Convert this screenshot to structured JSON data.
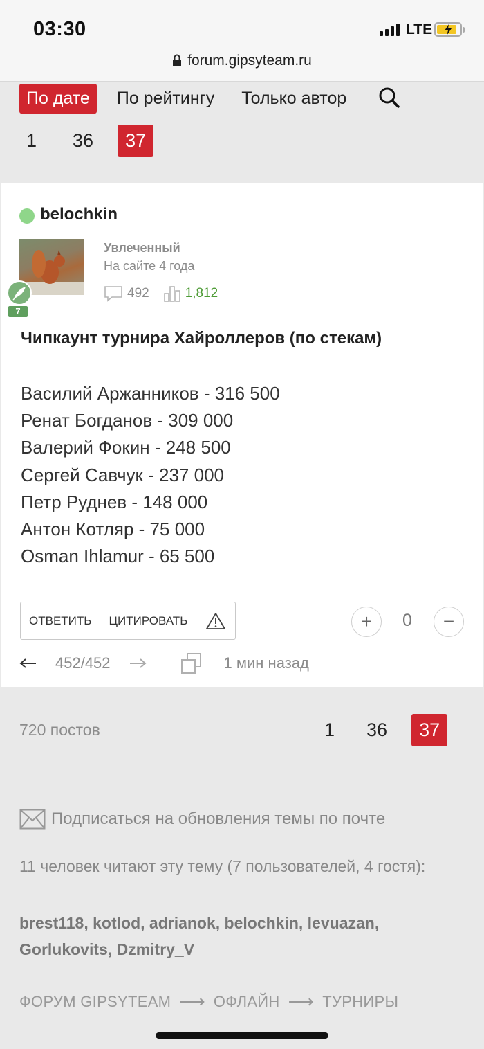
{
  "status_bar": {
    "time": "03:30",
    "network": "LTE"
  },
  "url_bar": {
    "url": "forum.gipsyteam.ru"
  },
  "sort_tabs": [
    "По дате",
    "По рейтингу",
    "Только автор"
  ],
  "pagination": [
    "1",
    "36",
    "37"
  ],
  "post": {
    "username": "belochkin",
    "rank": "Увлеченный",
    "on_site": "На сайте 4 года",
    "badge_level": "7",
    "posts_count": "492",
    "rating": "1,812",
    "title": "Чипкаунт турнира Хайроллеров (по стекам)",
    "lines": [
      "Василий Аржанников - 316 500",
      "Ренат Богданов - 309 000",
      "Валерий Фокин - 248 500",
      "Сергей Савчук - 237 000",
      "Петр Руднев - 148 000",
      "Антон Котляр - 75 000",
      "Osman Ihlamur - 65 500"
    ],
    "reply_label": "ОТВЕТИТЬ",
    "quote_label": "ЦИТИРОВАТЬ",
    "vote_plus": "+",
    "vote_count": "0",
    "vote_minus": "−",
    "position": "452/452",
    "time_ago": "1 мин назад"
  },
  "footer": {
    "post_count": "720 постов",
    "subscribe": "Подписаться на обновления темы по почте",
    "readers": "11 человек читают эту тему (7 пользователей, 4 гостя):",
    "users": "brest118, kotlod, adrianok, belochkin, levuazan, Gorlukovits, Dzmitry_V",
    "breadcrumbs": [
      "ФОРУМ GIPSYTEAM",
      "ОФЛАЙН",
      "ТУРНИРЫ"
    ]
  }
}
